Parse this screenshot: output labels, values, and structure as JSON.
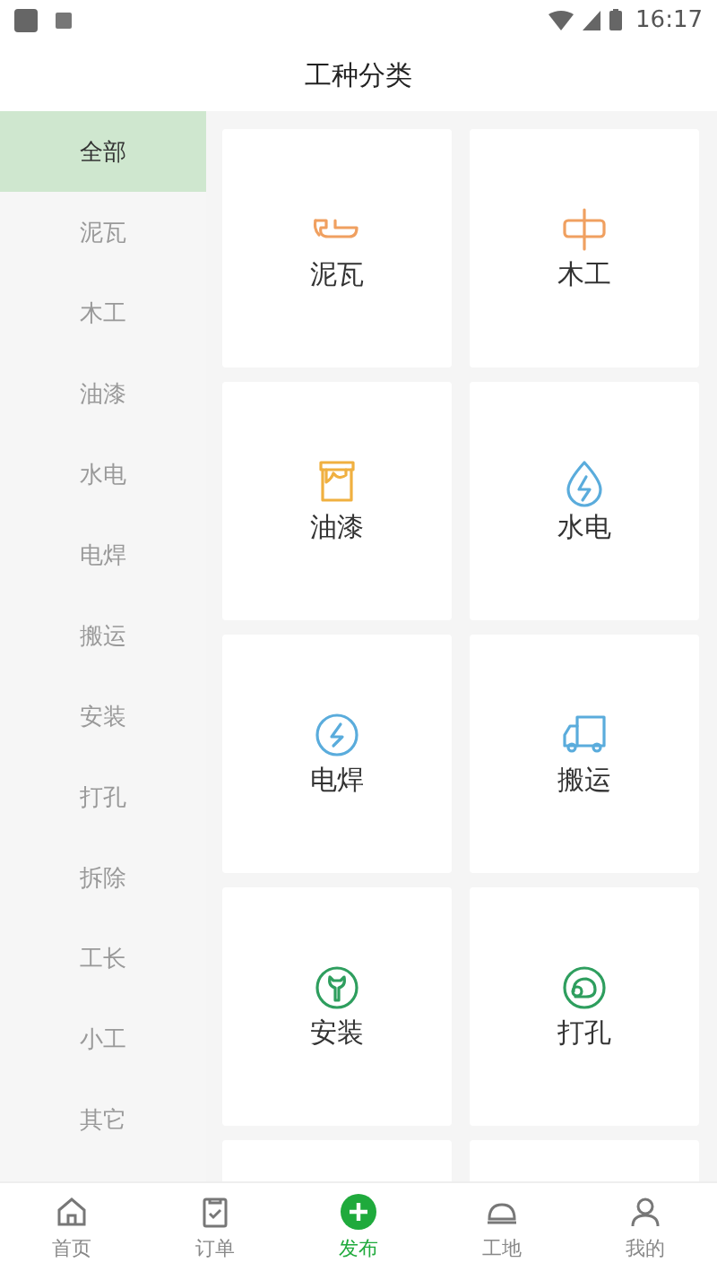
{
  "status_bar": {
    "time": "16:17"
  },
  "header": {
    "title": "工种分类"
  },
  "sidebar": {
    "items": [
      {
        "label": "全部",
        "selected": true
      },
      {
        "label": "泥瓦",
        "selected": false
      },
      {
        "label": "木工",
        "selected": false
      },
      {
        "label": "油漆",
        "selected": false
      },
      {
        "label": "水电",
        "selected": false
      },
      {
        "label": "电焊",
        "selected": false
      },
      {
        "label": "搬运",
        "selected": false
      },
      {
        "label": "安装",
        "selected": false
      },
      {
        "label": "打孔",
        "selected": false
      },
      {
        "label": "拆除",
        "selected": false
      },
      {
        "label": "工长",
        "selected": false
      },
      {
        "label": "小工",
        "selected": false
      },
      {
        "label": "其它",
        "selected": false
      }
    ]
  },
  "grid": {
    "items": [
      {
        "label": "泥瓦",
        "kind": "trowel",
        "color": "#f0a060"
      },
      {
        "label": "木工",
        "kind": "plank",
        "color": "#f0a060"
      },
      {
        "label": "油漆",
        "kind": "bucket",
        "color": "#f0b040"
      },
      {
        "label": "水电",
        "kind": "drop",
        "color": "#5aacdc"
      },
      {
        "label": "电焊",
        "kind": "bolt",
        "color": "#5aacdc"
      },
      {
        "label": "搬运",
        "kind": "truck",
        "color": "#5aacdc"
      },
      {
        "label": "安装",
        "kind": "wrench",
        "color": "#2e9e5e"
      },
      {
        "label": "打孔",
        "kind": "drill",
        "color": "#2e9e5e"
      }
    ]
  },
  "bottom_nav": [
    {
      "label": "首页",
      "kind": "home",
      "selected": false
    },
    {
      "label": "订单",
      "kind": "order",
      "selected": false
    },
    {
      "label": "发布",
      "kind": "publish",
      "selected": true
    },
    {
      "label": "工地",
      "kind": "site",
      "selected": false
    },
    {
      "label": "我的",
      "kind": "me",
      "selected": false
    }
  ]
}
